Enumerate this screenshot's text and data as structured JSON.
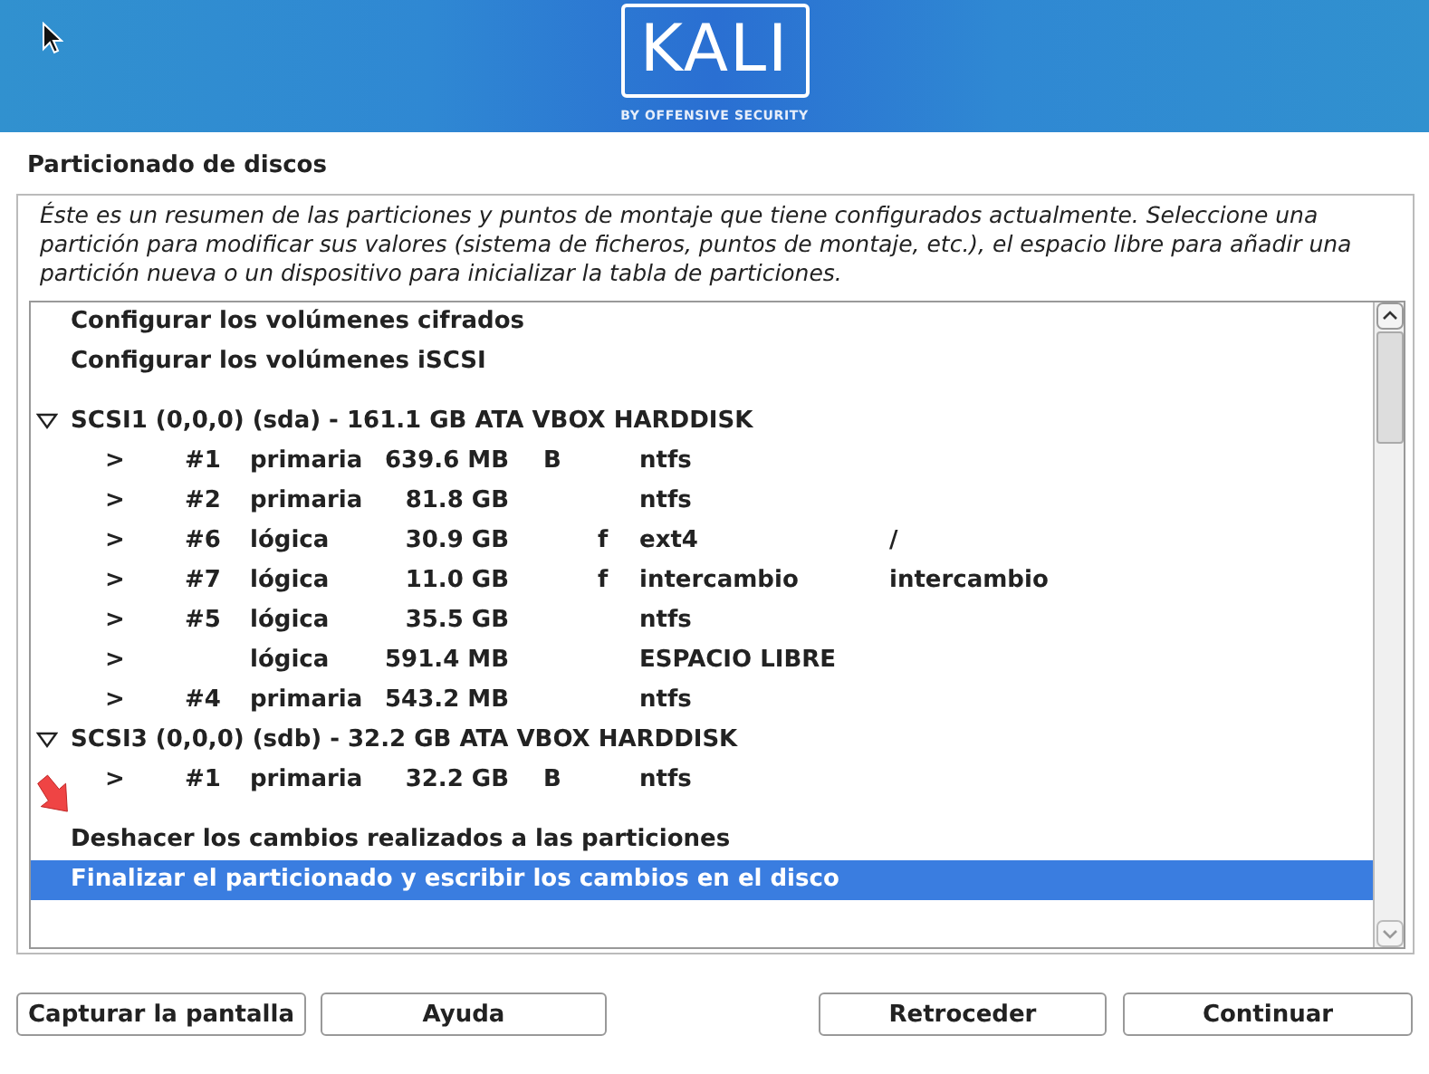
{
  "banner": {
    "logo": "KALI",
    "tagline": "BY OFFENSIVE SECURITY"
  },
  "title": "Particionado de discos",
  "description": "Éste es un resumen de las particiones y puntos de montaje que tiene configurados actualmente. Seleccione una partición para modificar sus valores (sistema de ficheros, puntos de montaje, etc.), el espacio libre para añadir una partición nueva o un dispositivo para inicializar la tabla de particiones.",
  "actions_top": [
    {
      "label": "Configurar los volúmenes cifrados",
      "selected": false
    },
    {
      "label": "Configurar los volúmenes iSCSI",
      "selected": false
    }
  ],
  "disks": [
    {
      "label": "SCSI1 (0,0,0) (sda) - 161.1 GB ATA VBOX HARDDISK",
      "expanded": true,
      "selected": false,
      "children": [
        {
          "marker": ">",
          "number": "#1",
          "type": "primaria",
          "size": "639.6 MB",
          "bootable": "B",
          "filesystem": "ntfs",
          "selected": false
        },
        {
          "marker": ">",
          "number": "#2",
          "type": "primaria",
          "size": "81.8 GB",
          "filesystem": "ntfs",
          "selected": false
        },
        {
          "marker": ">",
          "number": "#6",
          "type": "lógica",
          "size": "30.9 GB",
          "format": "f",
          "filesystem": "ext4",
          "mount": "/",
          "selected": false
        },
        {
          "marker": ">",
          "number": "#7",
          "type": "lógica",
          "size": "11.0 GB",
          "format": "f",
          "filesystem": "intercambio",
          "mount": "intercambio",
          "selected": false
        },
        {
          "marker": ">",
          "number": "#5",
          "type": "lógica",
          "size": "35.5 GB",
          "filesystem": "ntfs",
          "selected": false
        },
        {
          "marker": ">",
          "type": "lógica",
          "size": "591.4 MB",
          "filesystem": "ESPACIO LIBRE",
          "selected": false
        },
        {
          "marker": ">",
          "number": "#4",
          "type": "primaria",
          "size": "543.2 MB",
          "filesystem": "ntfs",
          "selected": false
        }
      ]
    },
    {
      "label": "SCSI3 (0,0,0) (sdb) - 32.2 GB ATA VBOX HARDDISK",
      "expanded": true,
      "selected": false,
      "children": [
        {
          "marker": ">",
          "number": "#1",
          "type": "primaria",
          "size": "32.2 GB",
          "bootable": "B",
          "filesystem": "ntfs",
          "selected": false
        }
      ]
    }
  ],
  "actions_bottom": [
    {
      "label": "Deshacer los cambios realizados a las particiones",
      "selected": false
    },
    {
      "label": "Finalizar el particionado y escribir los cambios en el disco",
      "selected": true
    }
  ],
  "buttons": [
    "Capturar la pantalla",
    "Ayuda",
    "Retroceder",
    "Continuar"
  ]
}
